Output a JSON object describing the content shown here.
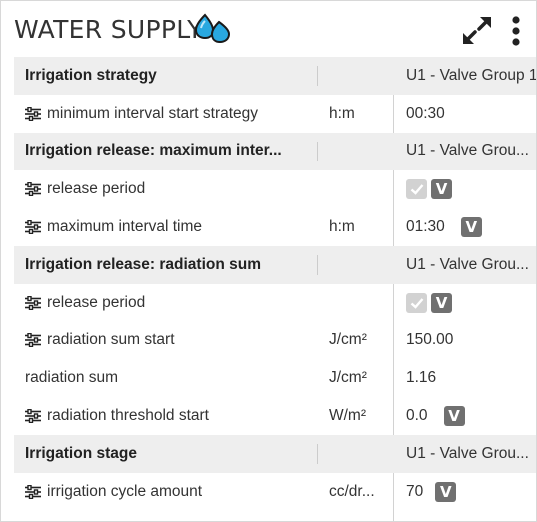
{
  "panel": {
    "title": "WATER SUPPLY",
    "title_icon": "water-drops-icon",
    "actions": [
      {
        "icon": "expand-arrows-icon"
      },
      {
        "icon": "more-vertical-icon"
      }
    ]
  },
  "colors": {
    "group_row_bg": "#eeeeee",
    "badge_v": "#707070",
    "badge_check": "#d2d2d2",
    "drop_blue": "#29a8e0"
  },
  "rows": [
    {
      "type": "group",
      "name": "Irrigation strategy",
      "unit": "",
      "value": "U1 - Valve Group 1"
    },
    {
      "type": "param",
      "icon": "settings-sliders-icon",
      "name": "minimum interval start strategy",
      "unit": "h:m",
      "value": "00:30"
    },
    {
      "type": "group",
      "name": "Irrigation release: maximum inter...",
      "unit": "",
      "value": "U1 - Valve Grou..."
    },
    {
      "type": "param",
      "icon": "settings-sliders-icon",
      "name": "release period",
      "unit": "",
      "value": "",
      "check": true,
      "badge": "V"
    },
    {
      "type": "param",
      "icon": "settings-sliders-icon",
      "name": "maximum interval time",
      "unit": "h:m",
      "value": "01:30",
      "badge": "V"
    },
    {
      "type": "group",
      "name": "Irrigation release: radiation sum",
      "unit": "",
      "value": "U1 - Valve Grou..."
    },
    {
      "type": "param",
      "icon": "settings-sliders-icon",
      "name": "release period",
      "unit": "",
      "value": "",
      "check": true,
      "badge": "V"
    },
    {
      "type": "param",
      "icon": "settings-sliders-icon",
      "name": "radiation sum start",
      "unit": "J/cm²",
      "value": "150.00"
    },
    {
      "type": "param",
      "name": "radiation sum",
      "unit": "J/cm²",
      "value": "1.16"
    },
    {
      "type": "param",
      "icon": "settings-sliders-icon",
      "name": "radiation threshold start",
      "unit": "W/m²",
      "value": "0.0",
      "badge": "V"
    },
    {
      "type": "group",
      "name": "Irrigation stage",
      "unit": "",
      "value": "U1 - Valve Grou..."
    },
    {
      "type": "param",
      "icon": "settings-sliders-icon",
      "name": "irrigation cycle amount",
      "unit": "cc/dr...",
      "value": "70",
      "badge": "V"
    }
  ]
}
